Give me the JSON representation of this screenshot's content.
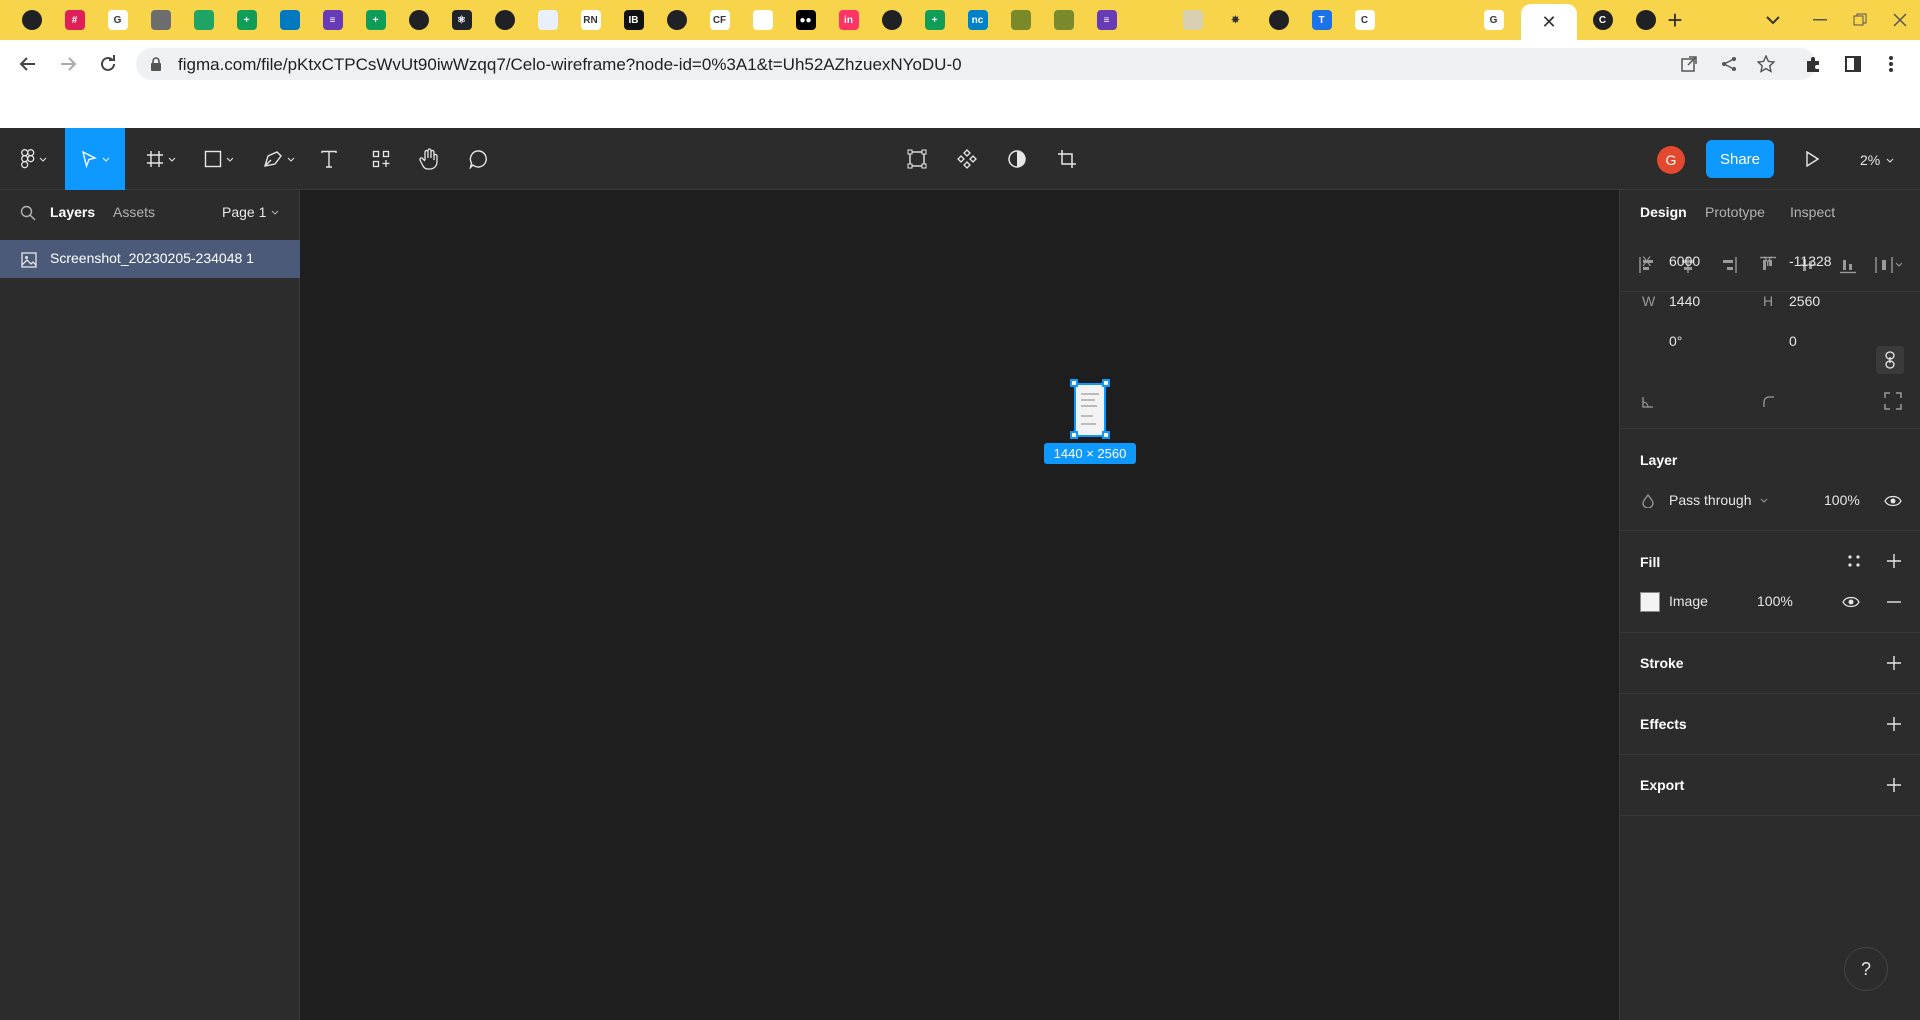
{
  "browser": {
    "tabs": [
      {
        "icon": "globe-icon",
        "bg": "#202124",
        "glyph": ""
      },
      {
        "icon": "slack-icon",
        "bg": "#e01e5a",
        "glyph": "#"
      },
      {
        "icon": "google-icon",
        "bg": "#ffffff",
        "glyph": "G"
      },
      {
        "icon": "tree-icon",
        "bg": "#6d6d6d",
        "glyph": ""
      },
      {
        "icon": "drive-icon",
        "bg": "#1fa463",
        "glyph": ""
      },
      {
        "icon": "sheets-icon",
        "bg": "#0f9d58",
        "glyph": "+"
      },
      {
        "icon": "trello-icon",
        "bg": "#0079bf",
        "glyph": ""
      },
      {
        "icon": "forms-icon",
        "bg": "#673ab7",
        "glyph": "≡"
      },
      {
        "icon": "sheets-icon",
        "bg": "#0f9d58",
        "glyph": "+"
      },
      {
        "icon": "globe-icon",
        "bg": "#202124",
        "glyph": ""
      },
      {
        "icon": "react-icon",
        "bg": "#20232a",
        "glyph": "⚛"
      },
      {
        "icon": "globe-icon",
        "bg": "#202124",
        "glyph": ""
      },
      {
        "icon": "arrow-icon",
        "bg": "#e8f0fe",
        "glyph": ""
      },
      {
        "icon": "rn-icon",
        "bg": "#ffffff",
        "glyph": "RN"
      },
      {
        "icon": "ib-icon",
        "bg": "#111111",
        "glyph": "IB"
      },
      {
        "icon": "swirl-icon",
        "bg": "#202124",
        "glyph": ""
      },
      {
        "icon": "cf-icon",
        "bg": "#ffffff",
        "glyph": "CF"
      },
      {
        "icon": "feather-icon",
        "bg": "#ffffff",
        "glyph": ""
      },
      {
        "icon": "medium-icon",
        "bg": "#000000",
        "glyph": "●●"
      },
      {
        "icon": "invision-icon",
        "bg": "#ff3366",
        "glyph": "in"
      },
      {
        "icon": "globe-icon",
        "bg": "#202124",
        "glyph": ""
      },
      {
        "icon": "sheets-icon",
        "bg": "#0f9d58",
        "glyph": "+"
      },
      {
        "icon": "nc-icon",
        "bg": "#0082c9",
        "glyph": "nc"
      },
      {
        "icon": "tree-icon",
        "bg": "#7a8a2a",
        "glyph": ""
      },
      {
        "icon": "tree-icon",
        "bg": "#7a8a2a",
        "glyph": ""
      },
      {
        "icon": "forms-icon",
        "bg": "#673ab7",
        "glyph": "≡"
      },
      {
        "icon": "figure-icon",
        "bg": "#f7d44a",
        "glyph": ""
      },
      {
        "icon": "map-icon",
        "bg": "#d8d0b0",
        "glyph": ""
      },
      {
        "icon": "sun-icon",
        "bg": "#f7d44a",
        "glyph": "✸"
      },
      {
        "icon": "podcast-icon",
        "bg": "#202124",
        "glyph": ""
      },
      {
        "icon": "t-icon",
        "bg": "#1a73e8",
        "glyph": "T"
      },
      {
        "icon": "c-icon",
        "bg": "#ffffff",
        "glyph": "C"
      },
      {
        "icon": "analytics-icon",
        "bg": "#f7d44a",
        "glyph": ""
      },
      {
        "icon": "analytics-icon",
        "bg": "#f7d44a",
        "glyph": ""
      },
      {
        "icon": "google-icon",
        "bg": "#ffffff",
        "glyph": "G"
      }
    ],
    "active_tab_close": "✕",
    "tabs_after": [
      {
        "icon": "c-icon",
        "bg": "#202124",
        "glyph": "C"
      },
      {
        "icon": "trello-icon",
        "bg": "#202124",
        "glyph": ""
      }
    ],
    "url": "figma.com/file/pKtxCTPCsWvUt90iwWzqq7/Celo-wireframe?node-id=0%3A1&t=Uh52AZhzuexNYoDU-0"
  },
  "figma": {
    "user_initial": "G",
    "share_label": "Share",
    "zoom": "2%",
    "left_panel": {
      "tab_layers": "Layers",
      "tab_assets": "Assets",
      "page": "Page 1",
      "layer_name": "Screenshot_20230205-234048 1"
    },
    "canvas": {
      "size_badge": "1440 × 2560"
    },
    "right_panel": {
      "tab_design": "Design",
      "tab_prototype": "Prototype",
      "tab_inspect": "Inspect",
      "x_label": "X",
      "x_value": "6000",
      "y_label": "Y",
      "y_value": "-11328",
      "w_label": "W",
      "w_value": "1440",
      "h_label": "H",
      "h_value": "2560",
      "rotation_value": "0°",
      "radius_value": "0",
      "layer_title": "Layer",
      "blend_mode": "Pass through",
      "layer_opacity": "100%",
      "fill_title": "Fill",
      "fill_type": "Image",
      "fill_opacity": "100%",
      "stroke_title": "Stroke",
      "effects_title": "Effects",
      "export_title": "Export"
    },
    "help_label": "?"
  },
  "colors": {
    "accent": "#0d99ff",
    "tabstrip": "#f7d44a",
    "panel": "#2c2c2c",
    "canvas": "#1e1e1e",
    "selected_layer": "#4c5a7a"
  }
}
